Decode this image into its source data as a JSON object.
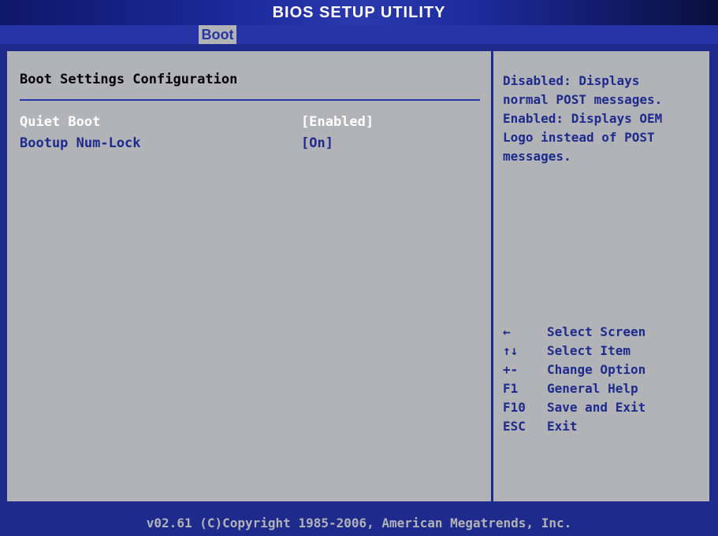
{
  "title": "BIOS SETUP UTILITY",
  "tabs": [
    {
      "label": "Boot"
    }
  ],
  "main": {
    "heading": "Boot Settings Configuration",
    "settings": [
      {
        "label": "Quiet Boot",
        "value": "[Enabled]"
      },
      {
        "label": "Bootup Num-Lock",
        "value": "[On]"
      }
    ]
  },
  "help": {
    "text": "Disabled: Displays\nnormal POST messages.\nEnabled: Displays OEM\nLogo instead of POST\nmessages."
  },
  "legend": [
    {
      "key": "←",
      "label": "Select Screen"
    },
    {
      "key": "↑↓",
      "label": "Select Item"
    },
    {
      "key": "+-",
      "label": "Change Option"
    },
    {
      "key": "F1",
      "label": "General Help"
    },
    {
      "key": "F10",
      "label": "Save and Exit"
    },
    {
      "key": "ESC",
      "label": "Exit"
    }
  ],
  "footer": "v02.61 (C)Copyright 1985-2006, American Megatrends, Inc.",
  "colors": {
    "background": "#1e2a8c",
    "panel": "#b1b3b7",
    "selected_text": "#ffffff",
    "text": "#1e2a8c"
  }
}
